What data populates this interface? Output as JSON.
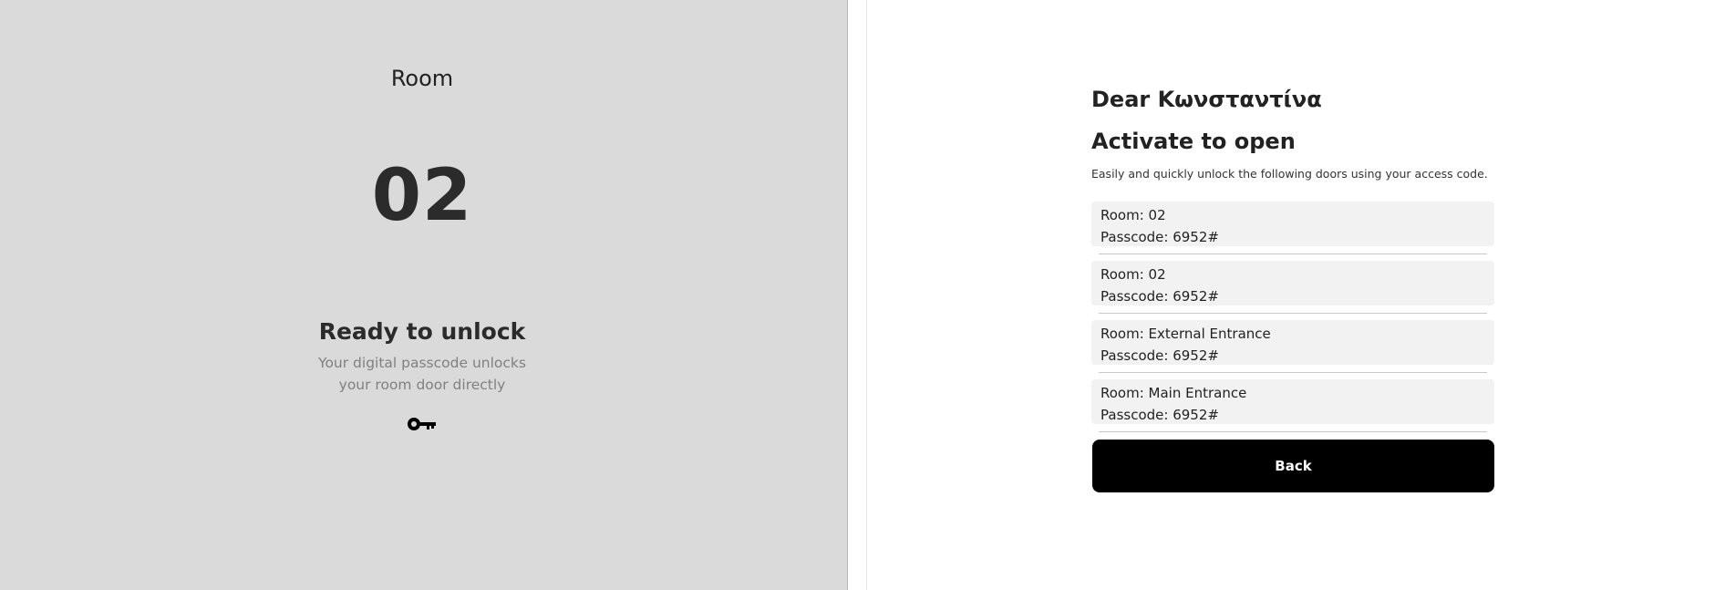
{
  "left": {
    "room_label": "Room",
    "room_number": "02",
    "status_title": "Ready to unlock",
    "status_description": "Your digital passcode unlocks your room door directly",
    "icon": "key-icon"
  },
  "right": {
    "greeting": "Dear Κωνσταντίνα",
    "title": "Activate to open",
    "instructions": "Easily and quickly unlock the following doors using your access code.",
    "doors": [
      {
        "room": "Room: 02",
        "passcode": "Passcode: 6952#"
      },
      {
        "room": "Room: 02",
        "passcode": "Passcode: 6952#"
      },
      {
        "room": "Room: External Entrance",
        "passcode": "Passcode: 6952#"
      },
      {
        "room": "Room: Main Entrance",
        "passcode": "Passcode: 6952#"
      }
    ],
    "back_label": "Back"
  },
  "colors": {
    "left_background": "#dadada",
    "item_background": "#f2f2f2",
    "button_background": "#000000",
    "button_text": "#ffffff"
  }
}
